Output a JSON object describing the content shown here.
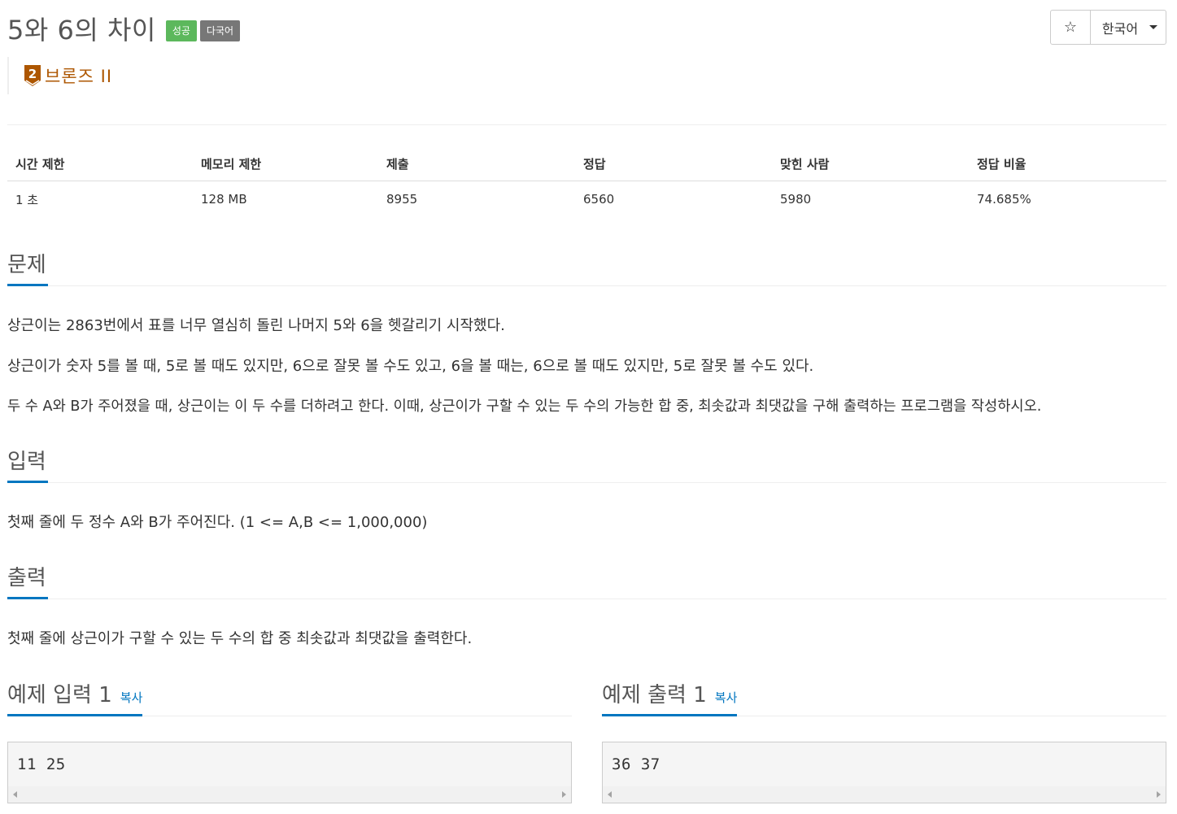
{
  "problem": {
    "title": "5와 6의 차이",
    "labels": [
      "성공",
      "다국어"
    ],
    "tier": "브론즈 II",
    "tier_number": "2"
  },
  "header": {
    "star": "☆",
    "language": "한국어"
  },
  "info_table": {
    "headers": [
      "시간 제한",
      "메모리 제한",
      "제출",
      "정답",
      "맞힌 사람",
      "정답 비율"
    ],
    "values": [
      "1 초",
      "128 MB",
      "8955",
      "6560",
      "5980",
      "74.685%"
    ]
  },
  "sections": {
    "problem": {
      "heading": "문제",
      "paragraphs": [
        "상근이는 2863번에서 표를 너무 열심히 돌린 나머지 5와 6을 헷갈리기 시작했다.",
        "상근이가 숫자 5를 볼 때, 5로 볼 때도 있지만, 6으로 잘못 볼 수도 있고, 6을 볼 때는, 6으로 볼 때도 있지만, 5로 잘못 볼 수도 있다.",
        "두 수 A와 B가 주어졌을 때, 상근이는 이 두 수를 더하려고 한다. 이때, 상근이가 구할 수 있는 두 수의 가능한 합 중, 최솟값과 최댓값을 구해 출력하는 프로그램을 작성하시오."
      ]
    },
    "input": {
      "heading": "입력",
      "text": "첫째 줄에 두 정수 A와 B가 주어진다. (1 <= A,B <= 1,000,000)"
    },
    "output": {
      "heading": "출력",
      "text": "첫째 줄에 상근이가 구할 수 있는 두 수의 합 중 최솟값과 최댓값을 출력한다."
    }
  },
  "samples": {
    "input": {
      "heading": "예제 입력 1",
      "copy": "복사",
      "content": "11 25"
    },
    "output": {
      "heading": "예제 출력 1",
      "copy": "복사",
      "content": "36 37"
    }
  }
}
